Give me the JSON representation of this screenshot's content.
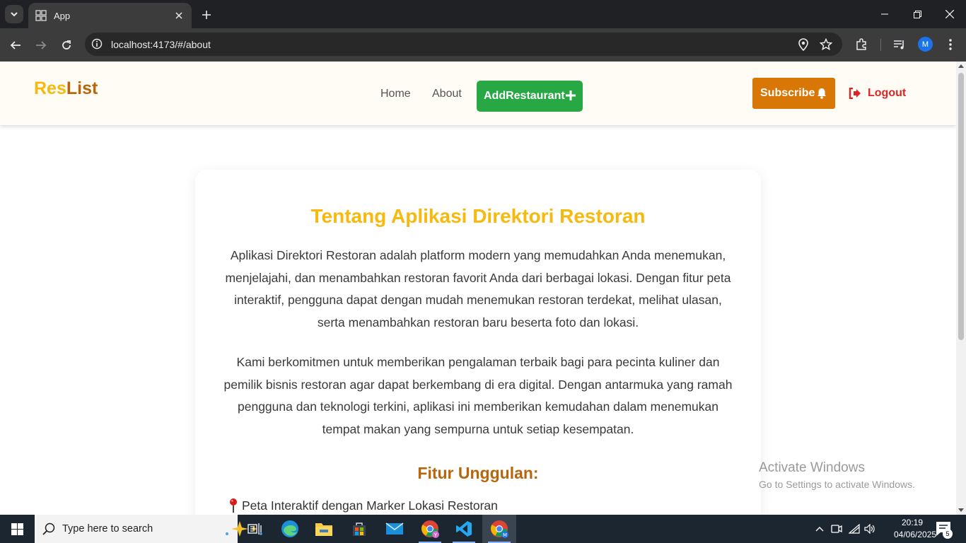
{
  "browser": {
    "tab_title": "App",
    "url": "localhost:4173/#/about",
    "profile_initial": "M"
  },
  "app": {
    "logo_part1": "Res",
    "logo_part2": "List",
    "nav": {
      "home": "Home",
      "about": "About",
      "add_restaurant": "AddRestaurant"
    },
    "subscribe_label": "Subscribe",
    "logout_label": "Logout",
    "colors": {
      "primary_yellow": "#f7b90e",
      "brown": "#b8660b",
      "green": "#27a844",
      "orange": "#d97706",
      "red": "#e02424"
    }
  },
  "about": {
    "title": "Tentang Aplikasi Direktori Restoran",
    "paragraph1": "Aplikasi Direktori Restoran adalah platform modern yang memudahkan Anda menemukan, menjelajahi, dan menambahkan restoran favorit Anda dari berbagai lokasi. Dengan fitur peta interaktif, pengguna dapat dengan mudah menemukan restoran terdekat, melihat ulasan, serta menambahkan restoran baru beserta foto dan lokasi.",
    "paragraph2": "Kami berkomitmen untuk memberikan pengalaman terbaik bagi para pecinta kuliner dan pemilik bisnis restoran agar dapat berkembang di era digital. Dengan antarmuka yang ramah pengguna dan teknologi terkini, aplikasi ini memberikan kemudahan dalam menemukan tempat makan yang sempurna untuk setiap kesempatan.",
    "features_title": "Fitur Unggulan:",
    "features": [
      "Peta Interaktif dengan Marker Lokasi Restoran"
    ]
  },
  "watermark": {
    "line1": "Activate Windows",
    "line2": "Go to Settings to activate Windows."
  },
  "taskbar": {
    "search_placeholder": "Type here to search",
    "time": "20:19",
    "date": "04/06/2025",
    "notification_count": "5"
  }
}
